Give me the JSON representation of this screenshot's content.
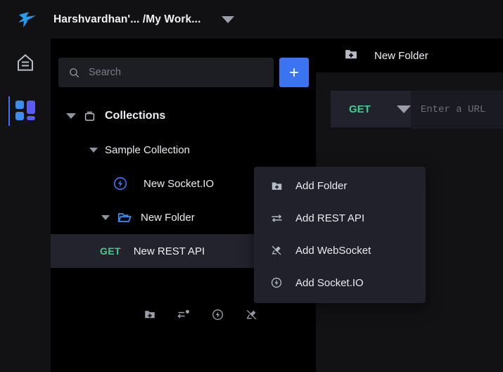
{
  "topbar": {
    "logo_icon": "hoppscotch-bird-logo",
    "workspace_title": "Harshvardhan'... /My Work...",
    "caret_icon": "chevron-down-icon"
  },
  "rail": {
    "items": [
      {
        "name": "home",
        "icon": "home-icon",
        "active": false
      },
      {
        "name": "collections",
        "icon": "collections-grid-icon",
        "active": true
      }
    ]
  },
  "panel": {
    "search": {
      "placeholder": "Search",
      "value": "",
      "icon": "search-icon"
    },
    "add_button": {
      "label": "+",
      "icon": "plus-icon",
      "color": "#3b74f0"
    },
    "tree": [
      {
        "label": "Collections",
        "icon": "archive-box-icon",
        "caret": "chevron-down-icon",
        "depth": 0,
        "selected": false
      },
      {
        "label": "Sample Collection",
        "icon": "",
        "caret": "chevron-down-icon",
        "depth": 1,
        "selected": false
      },
      {
        "label": "New Socket.IO",
        "icon": "socketio-bolt-icon",
        "caret": "",
        "depth": 2,
        "selected": false
      },
      {
        "label": "New Folder",
        "icon": "folder-open-icon",
        "caret": "chevron-down-icon",
        "depth": 2,
        "selected": false
      },
      {
        "label": "New REST API",
        "method": "GET",
        "icon": "",
        "caret": "",
        "depth": 3,
        "selected": true
      }
    ],
    "collection_plus": {
      "label": "+",
      "icon": "plus-icon"
    },
    "actions": [
      {
        "name": "add-folder",
        "icon": "folder-plus-icon"
      },
      {
        "name": "add-rest-api",
        "icon": "arrows-plus-icon"
      },
      {
        "name": "add-socketio",
        "icon": "bolt-circle-icon"
      },
      {
        "name": "add-websocket",
        "icon": "plug-icon"
      }
    ]
  },
  "rightpane": {
    "tab": {
      "label": "New Folder",
      "icon": "folder-plus-icon"
    },
    "request": {
      "method": "GET",
      "method_caret": "chevron-down-icon",
      "url_value": "",
      "url_placeholder": "Enter a URL"
    }
  },
  "context_menu": {
    "items": [
      {
        "label": "Add Folder",
        "icon": "folder-plus-icon"
      },
      {
        "label": "Add REST API",
        "icon": "arrows-exchange-icon"
      },
      {
        "label": "Add WebSocket",
        "icon": "plug-icon"
      },
      {
        "label": "Add Socket.IO",
        "icon": "bolt-circle-icon"
      }
    ]
  },
  "colors": {
    "accent_blue": "#3b74f0",
    "method_green": "#3ecf8e",
    "panel_bg": "#000000",
    "menu_bg": "#21212c",
    "selected_row": "#23232e"
  }
}
